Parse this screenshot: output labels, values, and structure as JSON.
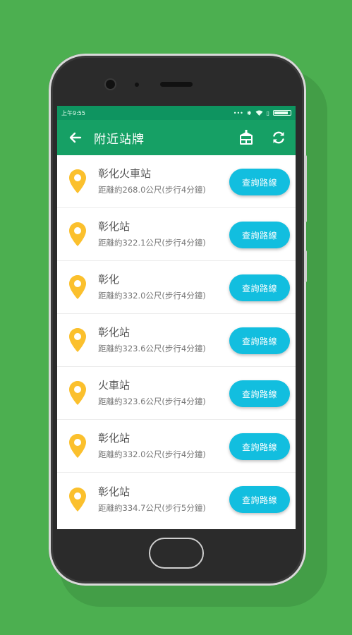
{
  "colors": {
    "background": "#4caf50",
    "statusbar": "#0e9460",
    "appbar": "#16a065",
    "button": "#12bedf",
    "pin": "#fbc02d"
  },
  "statusbar": {
    "time": "上午9:55",
    "icons": [
      "signal-dots-icon",
      "bluetooth-icon",
      "wifi-icon",
      "vibrate-icon",
      "battery-icon"
    ]
  },
  "appbar": {
    "title": "附近站牌",
    "back_icon": "arrow-left-icon",
    "actions": [
      "bus-stop-sign-icon",
      "refresh-icon"
    ]
  },
  "stops": [
    {
      "name": "彰化火車站",
      "distance": "距離約268.0公尺(步行4分鐘)",
      "button": "查詢路線"
    },
    {
      "name": "彰化站",
      "distance": "距離約322.1公尺(步行4分鐘)",
      "button": "查詢路線"
    },
    {
      "name": "彰化",
      "distance": "距離約332.0公尺(步行4分鐘)",
      "button": "查詢路線"
    },
    {
      "name": "彰化站",
      "distance": "距離約323.6公尺(步行4分鐘)",
      "button": "查詢路線"
    },
    {
      "name": "火車站",
      "distance": "距離約323.6公尺(步行4分鐘)",
      "button": "查詢路線"
    },
    {
      "name": "彰化站",
      "distance": "距離約332.0公尺(步行4分鐘)",
      "button": "查詢路線"
    },
    {
      "name": "彰化站",
      "distance": "距離約334.7公尺(步行5分鐘)",
      "button": "查詢路線"
    }
  ]
}
